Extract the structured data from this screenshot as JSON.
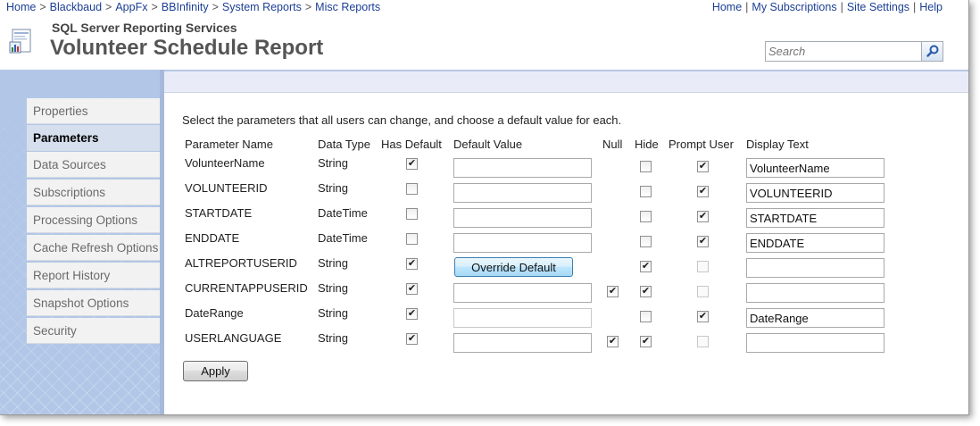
{
  "breadcrumb": [
    "Home",
    "Blackbaud",
    "AppFx",
    "BBInfinity",
    "System Reports",
    "Misc Reports"
  ],
  "breadcrumb_separator": ">",
  "top_links": [
    "Home",
    "My Subscriptions",
    "Site Settings",
    "Help"
  ],
  "top_links_separator": "|",
  "suite_title": "SQL Server Reporting Services",
  "page_title": "Volunteer Schedule Report",
  "search": {
    "placeholder": "Search"
  },
  "nav": {
    "items": [
      "Properties",
      "Parameters",
      "Data Sources",
      "Subscriptions",
      "Processing Options",
      "Cache Refresh Options",
      "Report History",
      "Snapshot Options",
      "Security"
    ],
    "active": "Parameters"
  },
  "instructions": "Select the parameters that all users can change, and choose a default value for each.",
  "columns": {
    "name": "Parameter Name",
    "type": "Data Type",
    "has_default": "Has Default",
    "default_value": "Default Value",
    "null": "Null",
    "hide": "Hide",
    "prompt": "Prompt User",
    "display": "Display Text"
  },
  "rows": [
    {
      "name": "VolunteerName",
      "type": "String",
      "has_default": true,
      "default_value": "",
      "null": null,
      "hide": false,
      "prompt": true,
      "display": "VolunteerName"
    },
    {
      "name": "VOLUNTEERID",
      "type": "String",
      "has_default": false,
      "default_value": "",
      "null": null,
      "hide": false,
      "prompt": true,
      "display": "VOLUNTEERID"
    },
    {
      "name": "STARTDATE",
      "type": "DateTime",
      "has_default": false,
      "default_value": "",
      "null": null,
      "hide": false,
      "prompt": true,
      "display": "STARTDATE"
    },
    {
      "name": "ENDDATE",
      "type": "DateTime",
      "has_default": false,
      "default_value": "",
      "null": null,
      "hide": false,
      "prompt": true,
      "display": "ENDDATE"
    },
    {
      "name": "ALTREPORTUSERID",
      "type": "String",
      "has_default": true,
      "default_button": "Override Default",
      "null": null,
      "hide": true,
      "prompt": false,
      "prompt_disabled": true,
      "display": ""
    },
    {
      "name": "CURRENTAPPUSERID",
      "type": "String",
      "has_default": true,
      "default_value": "",
      "null": true,
      "hide": true,
      "prompt": false,
      "prompt_disabled": true,
      "display": ""
    },
    {
      "name": "DateRange",
      "type": "String",
      "has_default": true,
      "default_value": "",
      "default_disabled": true,
      "null": null,
      "hide": false,
      "prompt": true,
      "display": "DateRange"
    },
    {
      "name": "USERLANGUAGE",
      "type": "String",
      "has_default": true,
      "default_value": "",
      "null": true,
      "hide": true,
      "prompt": false,
      "prompt_disabled": true,
      "display": ""
    }
  ],
  "apply_label": "Apply",
  "colors": {
    "link": "#1c3f94",
    "nav_background": "#b2c7e7",
    "nav_active": "#d6dfee",
    "header_band": "#e9ecf8"
  },
  "icons": {
    "report": "report-icon",
    "search": "search-icon",
    "check": "check-icon"
  }
}
